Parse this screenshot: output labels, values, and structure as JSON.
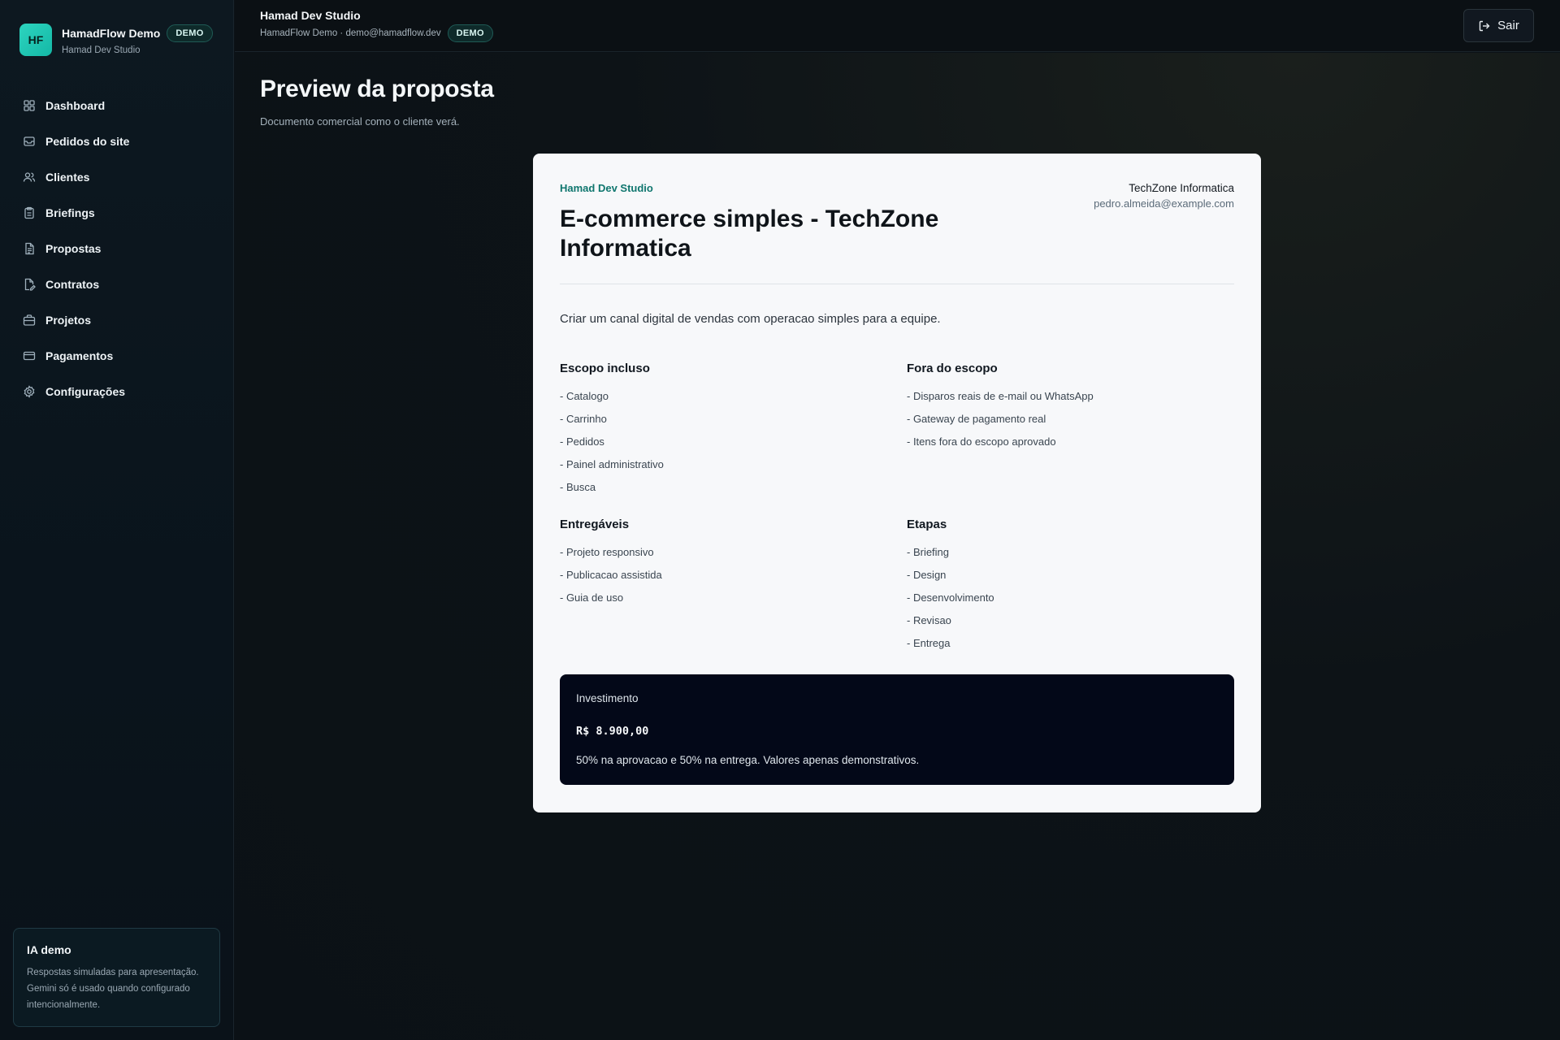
{
  "brand": {
    "logo_text": "HF",
    "name": "HamadFlow Demo",
    "badge": "DEMO",
    "subtitle": "Hamad Dev Studio"
  },
  "sidebar": {
    "items": [
      {
        "label": "Dashboard",
        "icon": "grid-icon"
      },
      {
        "label": "Pedidos do site",
        "icon": "inbox-icon"
      },
      {
        "label": "Clientes",
        "icon": "users-icon"
      },
      {
        "label": "Briefings",
        "icon": "clipboard-icon"
      },
      {
        "label": "Propostas",
        "icon": "file-text-icon"
      },
      {
        "label": "Contratos",
        "icon": "file-pen-icon"
      },
      {
        "label": "Projetos",
        "icon": "briefcase-icon"
      },
      {
        "label": "Pagamentos",
        "icon": "credit-card-icon"
      },
      {
        "label": "Configurações",
        "icon": "gear-icon"
      }
    ],
    "ai_card": {
      "title": "IA demo",
      "text": "Respostas simuladas para apresentação. Gemini só é usado quando configurado intencionalmente."
    }
  },
  "header": {
    "title": "Hamad Dev Studio",
    "subtitle": "HamadFlow Demo · demo@hamadflow.dev",
    "badge": "DEMO",
    "logout_label": "Sair"
  },
  "page": {
    "title": "Preview da proposta",
    "subtitle": "Documento comercial como o cliente verá."
  },
  "proposal": {
    "studio": "Hamad Dev Studio",
    "title": "E-commerce simples - TechZone Informatica",
    "client_name": "TechZone Informatica",
    "client_email": "pedro.almeida@example.com",
    "summary": "Criar um canal digital de vendas com operacao simples para a equipe.",
    "scope_in": {
      "title": "Escopo incluso",
      "items": [
        "- Catalogo",
        "- Carrinho",
        "- Pedidos",
        "- Painel administrativo",
        "- Busca"
      ]
    },
    "scope_out": {
      "title": "Fora do escopo",
      "items": [
        "- Disparos reais de e-mail ou WhatsApp",
        "- Gateway de pagamento real",
        "- Itens fora do escopo aprovado"
      ]
    },
    "deliverables": {
      "title": "Entregáveis",
      "items": [
        "- Projeto responsivo",
        "- Publicacao assistida",
        "- Guia de uso"
      ]
    },
    "stages": {
      "title": "Etapas",
      "items": [
        "- Briefing",
        "- Design",
        "- Desenvolvimento",
        "- Revisao",
        "- Entrega"
      ]
    },
    "investment": {
      "label": "Investimento",
      "value": "R$ 8.900,00",
      "note": "50% na aprovacao e 50% na entrega. Valores apenas demonstrativos."
    }
  }
}
